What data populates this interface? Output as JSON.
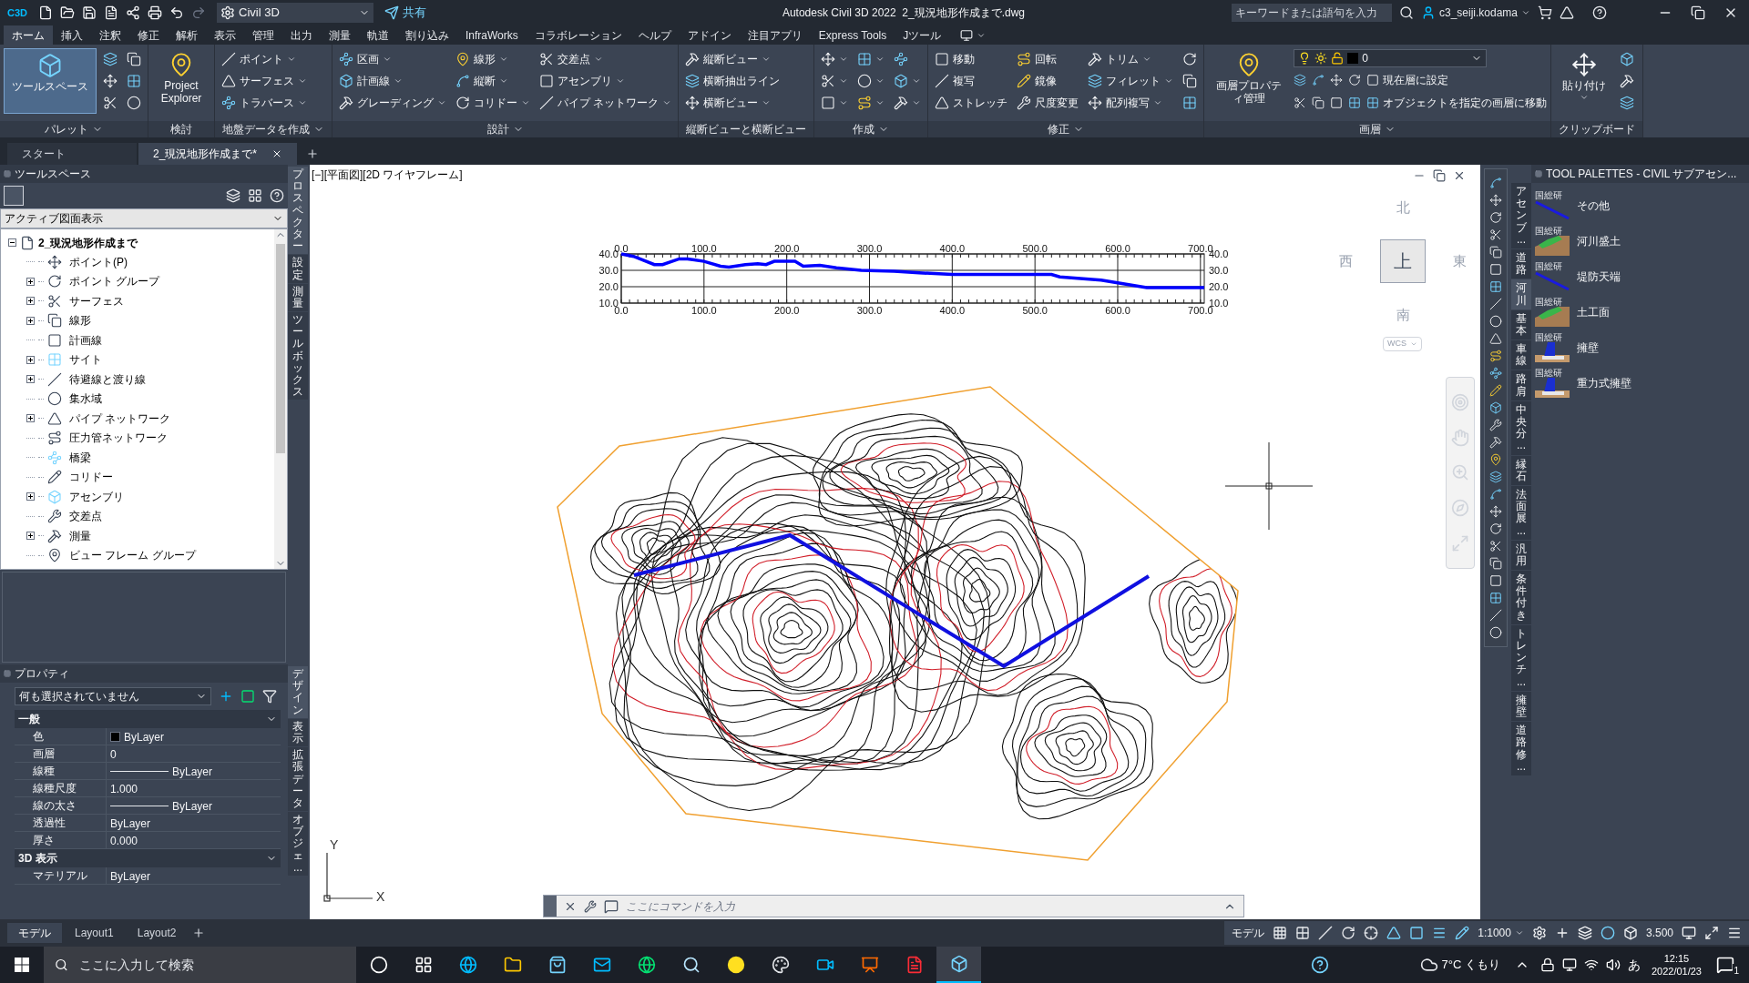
{
  "title_bar": {
    "logo": "C3D",
    "workspace": "Civil 3D",
    "share": "共有",
    "title": "Autodesk Civil 3D 2022  2_現況地形作成まで.dwg",
    "search_placeholder": "キーワードまたは語句を入力",
    "user": "c3_seiji.kodama"
  },
  "ribbon_tabs": [
    {
      "label": "ホーム",
      "selected": true
    },
    {
      "label": "挿入",
      "selected": false
    },
    {
      "label": "注釈",
      "selected": false
    },
    {
      "label": "修正",
      "selected": false
    },
    {
      "label": "解析",
      "selected": false
    },
    {
      "label": "表示",
      "selected": false
    },
    {
      "label": "管理",
      "selected": false
    },
    {
      "label": "出力",
      "selected": false
    },
    {
      "label": "測量",
      "selected": false
    },
    {
      "label": "軌道",
      "selected": false
    },
    {
      "label": "割り込み",
      "selected": false
    },
    {
      "label": "InfraWorks",
      "selected": false
    },
    {
      "label": "コラボレーション",
      "selected": false
    },
    {
      "label": "ヘルプ",
      "selected": false
    },
    {
      "label": "アドイン",
      "selected": false
    },
    {
      "label": "注目アプリ",
      "selected": false
    },
    {
      "label": "Express Tools",
      "selected": false
    },
    {
      "label": "Jツール",
      "selected": false
    }
  ],
  "ribbon_panels": [
    {
      "kind": "standard",
      "title": "パレット",
      "menu": true,
      "large": [
        {
          "label": "ツールスペース",
          "active": true,
          "dropdown": false
        }
      ],
      "columns": [
        [
          {
            "dropdown": false
          },
          {
            "dropdown": false
          },
          {
            "dropdown": false
          }
        ],
        [
          {
            "dropdown": false
          },
          {
            "dropdown": false
          },
          {
            "dropdown": false
          }
        ]
      ]
    },
    {
      "kind": "standard",
      "title": "検討",
      "menu": false,
      "large": [
        {
          "label": "Project Explorer",
          "active": false,
          "dropdown": false
        }
      ]
    },
    {
      "kind": "standard",
      "title": "地盤データを作成",
      "menu": true,
      "columns": [
        [
          {
            "label": "ポイント",
            "dropdown": true
          },
          {
            "label": "サーフェス",
            "dropdown": true
          },
          {
            "label": "トラバース",
            "dropdown": true
          }
        ]
      ]
    },
    {
      "kind": "standard",
      "title": "設計",
      "menu": true,
      "columns": [
        [
          {
            "label": "区画",
            "dropdown": true
          },
          {
            "label": "計画線",
            "dropdown": true
          },
          {
            "label": "グレーディング",
            "dropdown": true
          }
        ],
        [
          {
            "label": "線形",
            "dropdown": true
          },
          {
            "label": "縦断",
            "dropdown": true
          },
          {
            "label": "コリドー",
            "dropdown": true
          }
        ],
        [
          {
            "label": "交差点",
            "dropdown": true
          },
          {
            "label": "アセンブリ",
            "dropdown": true
          },
          {
            "label": "パイプ ネットワーク",
            "dropdown": true
          }
        ]
      ]
    },
    {
      "kind": "standard",
      "title": "縦断ビューと横断ビュー",
      "menu": false,
      "columns": [
        [
          {
            "label": "縦断ビュー",
            "dropdown": true
          },
          {
            "label": "横断抽出ライン",
            "dropdown": false
          },
          {
            "label": "横断ビュー",
            "dropdown": true
          }
        ]
      ]
    },
    {
      "kind": "standard",
      "title": "作成",
      "menu": true,
      "columns": [
        [
          {
            "dropdown": true
          },
          {
            "dropdown": true
          },
          {
            "dropdown": true
          }
        ],
        [
          {
            "dropdown": true
          },
          {
            "dropdown": true
          },
          {
            "dropdown": true
          }
        ],
        [
          {
            "dropdown": false
          },
          {
            "dropdown": true
          },
          {
            "dropdown": true
          }
        ]
      ]
    },
    {
      "kind": "standard",
      "title": "修正",
      "menu": true,
      "columns": [
        [
          {
            "label": "移動",
            "dropdown": false
          },
          {
            "label": "複写",
            "dropdown": false
          },
          {
            "label": "ストレッチ",
            "dropdown": false
          }
        ],
        [
          {
            "label": "回転",
            "dropdown": false
          },
          {
            "label": "鏡像",
            "dropdown": false
          },
          {
            "label": "尺度変更",
            "dropdown": false
          }
        ],
        [
          {
            "label": "トリム",
            "dropdown": true
          },
          {
            "label": "フィレット",
            "dropdown": true
          },
          {
            "label": "配列複写",
            "dropdown": true
          }
        ],
        [
          {
            "dropdown": false
          },
          {
            "dropdown": false
          },
          {
            "dropdown": false
          }
        ]
      ]
    },
    {
      "kind": "layer",
      "title": "画層",
      "menu": true,
      "large": [
        {
          "label": "画層プロパティ管理",
          "active": false,
          "dropdown": false
        }
      ],
      "combo": "0",
      "rows": [
        {
          "label": "現在層に設定"
        },
        {
          "label": "オブジェクトを指定の画層に移動"
        }
      ]
    },
    {
      "kind": "standard",
      "title": "クリップボード",
      "menu": false,
      "large": [
        {
          "label": "貼り付け",
          "active": false,
          "dropdown": true
        }
      ],
      "columns": [
        [
          {
            "dropdown": false
          },
          {
            "dropdown": false
          },
          {
            "dropdown": false
          }
        ]
      ]
    }
  ],
  "doc_tabs": [
    {
      "label": "スタート",
      "selected": false
    },
    {
      "label": "2_現況地形作成まで*",
      "selected": true
    }
  ],
  "toolspace": {
    "title": "ツールスペース",
    "view": "アクティブ図面表示",
    "root": {
      "label": "2_現況地形作成まで",
      "expanded": true
    },
    "items": [
      {
        "label": "ポイント(P)",
        "expandable": false
      },
      {
        "label": "ポイント グループ",
        "expandable": true
      },
      {
        "label": "サーフェス",
        "expandable": true
      },
      {
        "label": "線形",
        "expandable": true
      },
      {
        "label": "計画線",
        "expandable": false
      },
      {
        "label": "サイト",
        "expandable": true
      },
      {
        "label": "待避線と渡り線",
        "expandable": true
      },
      {
        "label": "集水域",
        "expandable": false
      },
      {
        "label": "パイプ ネットワーク",
        "expandable": true
      },
      {
        "label": "圧力管ネットワーク",
        "expandable": false
      },
      {
        "label": "橋梁",
        "expandable": false
      },
      {
        "label": "コリドー",
        "expandable": false
      },
      {
        "label": "アセンブリ",
        "expandable": true
      },
      {
        "label": "交差点",
        "expandable": false
      },
      {
        "label": "測量",
        "expandable": true
      },
      {
        "label": "ビュー フレーム グループ",
        "expandable": false
      }
    ],
    "side_tabs": [
      {
        "label": "プロスペクター",
        "selected": true
      },
      {
        "label": "設定",
        "selected": false
      },
      {
        "label": "測量",
        "selected": false
      },
      {
        "label": "ツールボックス",
        "selected": false
      }
    ]
  },
  "properties": {
    "title": "プロパティ",
    "selection": "何も選択されていません",
    "sections": [
      {
        "title": "一般",
        "rows": [
          {
            "name": "色",
            "value": "ByLayer",
            "kind": "swatch"
          },
          {
            "name": "画層",
            "value": "0",
            "kind": "text"
          },
          {
            "name": "線種",
            "value": "ByLayer",
            "kind": "line"
          },
          {
            "name": "線種尺度",
            "value": "1.000",
            "kind": "text"
          },
          {
            "name": "線の太さ",
            "value": "ByLayer",
            "kind": "line"
          },
          {
            "name": "透過性",
            "value": "ByLayer",
            "kind": "text"
          },
          {
            "name": "厚さ",
            "value": "0.000",
            "kind": "text"
          }
        ]
      },
      {
        "title": "3D 表示",
        "rows": [
          {
            "name": "マテリアル",
            "value": "ByLayer",
            "kind": "text"
          }
        ]
      }
    ],
    "side_tabs": [
      {
        "label": "デザイン",
        "selected": true
      },
      {
        "label": "表示",
        "selected": false
      },
      {
        "label": "拡張データ",
        "selected": false
      },
      {
        "label": "オブジェ...",
        "selected": false
      }
    ]
  },
  "viewport": {
    "controls": [
      "[−]",
      "[平面図]",
      "[2D ワイヤフレーム]"
    ],
    "viewcube": {
      "north": "北",
      "south": "南",
      "east": "東",
      "west": "西",
      "face": "上",
      "ucs": "WCS"
    },
    "ucs_axes": {
      "x": "X",
      "y": "Y"
    },
    "profile": {
      "chart_data": {
        "type": "line",
        "x": [
          0,
          15,
          40,
          50,
          70,
          80,
          100,
          120,
          130,
          150,
          165,
          175,
          185,
          210,
          220,
          240,
          260,
          290,
          330,
          360,
          400,
          520,
          530,
          580,
          610,
          635,
          704.6
        ],
        "series": [
          {
            "color": "#0000ff",
            "values": [
              40,
              38.5,
              33.5,
              33.5,
              37,
              37,
              35.5,
              32.5,
              32,
              33.5,
              34,
              33.5,
              35.5,
              35.5,
              32.5,
              33,
              31.5,
              30,
              29.5,
              28.5,
              27.5,
              27.5,
              26,
              24,
              21.5,
              19.5,
              19.5
            ]
          }
        ],
        "xlim": [
          0,
          704.6
        ],
        "ylim": [
          10,
          40
        ],
        "grid": true,
        "xticks": [
          {
            "value": 0,
            "label": "0.0"
          },
          {
            "value": 100,
            "label": "100.0"
          },
          {
            "value": 200,
            "label": "200.0"
          },
          {
            "value": 300,
            "label": "300.0"
          },
          {
            "value": 400,
            "label": "400.0"
          },
          {
            "value": 500,
            "label": "500.0"
          },
          {
            "value": 600,
            "label": "600.0"
          },
          {
            "value": 700,
            "label": "700.0"
          }
        ],
        "yticks": [
          {
            "value": 10,
            "label": "10.0"
          },
          {
            "value": 20,
            "label": "20.0"
          },
          {
            "value": 30,
            "label": "30.0"
          },
          {
            "value": 40,
            "label": "40.0"
          }
        ]
      }
    },
    "command_placeholder": "ここにコマンドを入力"
  },
  "palette": {
    "title": "TOOL PALETTES - CIVIL サブアセン...",
    "items": [
      {
        "badge": "国総研",
        "label": "その他",
        "kind": "line"
      },
      {
        "badge": "国総研",
        "label": "河川盛土",
        "kind": "slope"
      },
      {
        "badge": "国総研",
        "label": "堤防天端",
        "kind": "line"
      },
      {
        "badge": "国総研",
        "label": "土工面",
        "kind": "slope"
      },
      {
        "badge": "国総研",
        "label": "擁壁",
        "kind": "wall"
      },
      {
        "badge": "国総研",
        "label": "重力式擁壁",
        "kind": "wall"
      }
    ],
    "tabs": [
      {
        "label": "アセンブ...",
        "selected": false
      },
      {
        "label": "道路",
        "selected": false
      },
      {
        "label": "河川",
        "selected": true
      },
      {
        "label": "基本",
        "selected": false
      },
      {
        "label": "車線",
        "selected": false
      },
      {
        "label": "路肩",
        "selected": false
      },
      {
        "label": "中央分...",
        "selected": false
      },
      {
        "label": "縁石",
        "selected": false
      },
      {
        "label": "法面展...",
        "selected": false
      },
      {
        "label": "汎用",
        "selected": false
      },
      {
        "label": "条件付き",
        "selected": false
      },
      {
        "label": "トレンチ...",
        "selected": false
      },
      {
        "label": "擁壁",
        "selected": false
      },
      {
        "label": "道路修...",
        "selected": false
      }
    ]
  },
  "layout_tabs": [
    {
      "label": "モデル",
      "selected": true
    },
    {
      "label": "Layout1",
      "selected": false
    },
    {
      "label": "Layout2",
      "selected": false
    }
  ],
  "status_bar": {
    "space": "モデル",
    "scale": "1:1000",
    "value": "3.500"
  },
  "taskbar": {
    "search_placeholder": "ここに入力して検索",
    "weather": "7°C くもり",
    "ime": "あ",
    "time": "12:15",
    "date": "2022/01/23",
    "notifications": "1"
  }
}
